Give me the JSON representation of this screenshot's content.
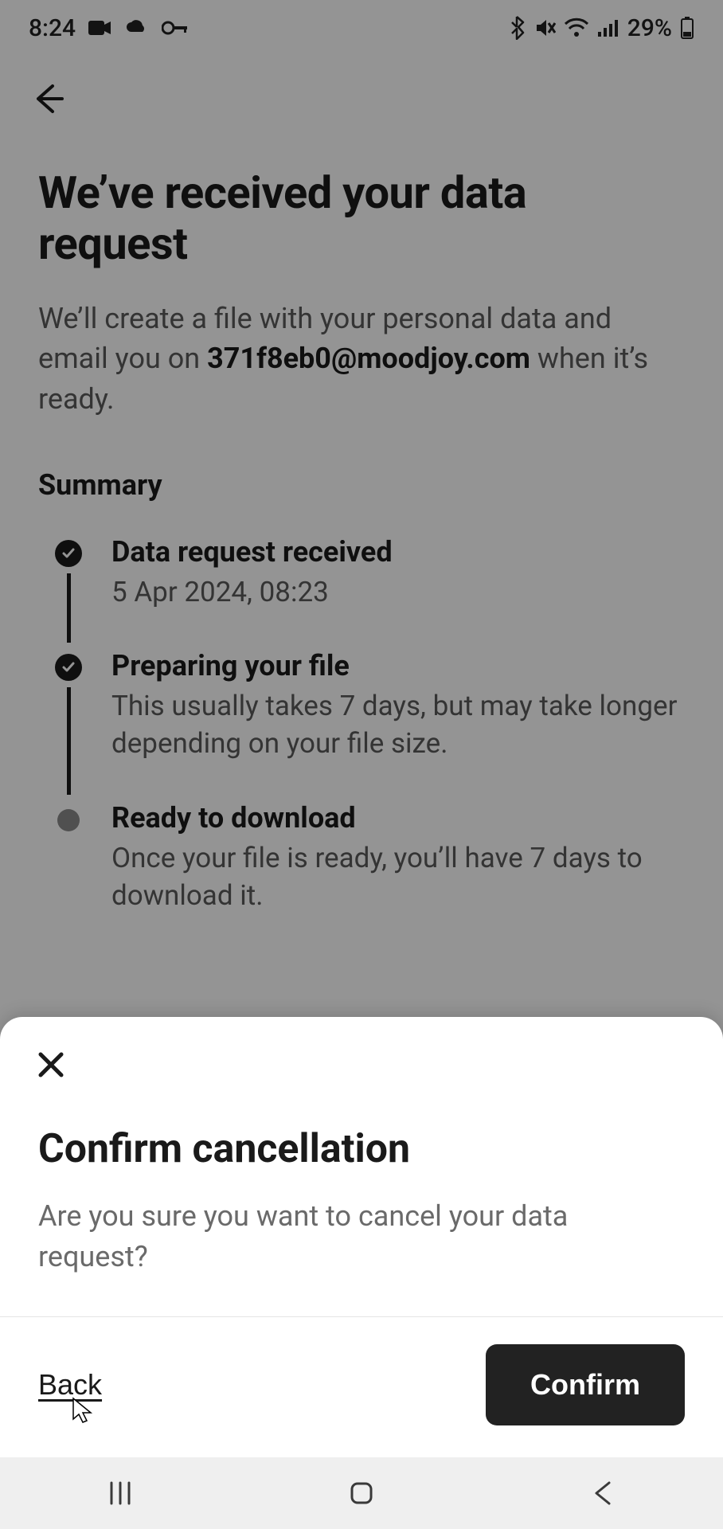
{
  "status_bar": {
    "time": "8:24",
    "battery_text": "29%"
  },
  "page": {
    "title": "We’ve received your data request",
    "subtitle_before": "We’ll create a file with your personal data and email you on ",
    "email": "371f8eb0@moodjoy.com",
    "subtitle_after": " when it’s ready.",
    "summary_heading": "Summary"
  },
  "timeline": [
    {
      "status": "done",
      "title": "Data request received",
      "text": "5 Apr 2024, 08:23"
    },
    {
      "status": "done",
      "title": "Preparing your file",
      "text": "This usually takes 7 days, but may take longer depending on your file size."
    },
    {
      "status": "pending",
      "title": "Ready to download",
      "text": "Once your file is ready, you’ll have 7 days to download it."
    }
  ],
  "sheet": {
    "title": "Confirm cancellation",
    "text": "Are you sure you want to cancel your data request?",
    "back_label": "Back",
    "confirm_label": "Confirm"
  }
}
